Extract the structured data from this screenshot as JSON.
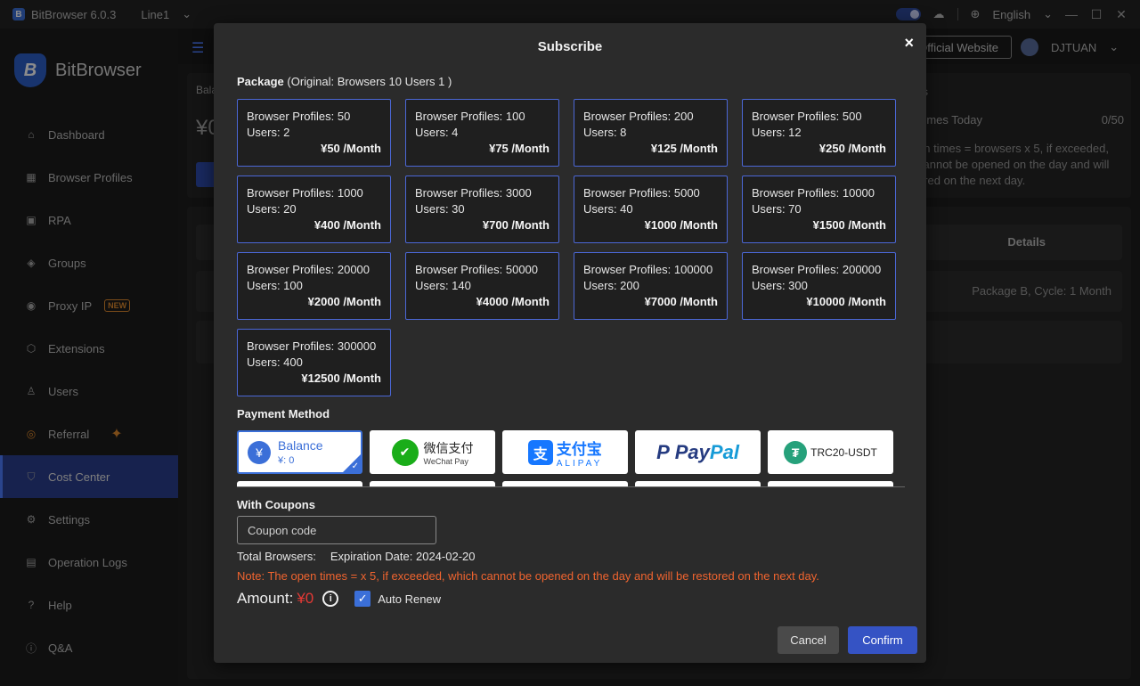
{
  "titlebar": {
    "app_title": "BitBrowser 6.0.3",
    "line": "Line1",
    "language": "English"
  },
  "sidebar": {
    "brand": "BitBrowser",
    "items": [
      {
        "label": "Dashboard",
        "icon": "home-icon"
      },
      {
        "label": "Browser Profiles",
        "icon": "grid-icon"
      },
      {
        "label": "RPA",
        "icon": "robot-icon"
      },
      {
        "label": "Groups",
        "icon": "layers-icon"
      },
      {
        "label": "Proxy IP",
        "icon": "location-icon",
        "badge": "NEW"
      },
      {
        "label": "Extensions",
        "icon": "cube-icon"
      },
      {
        "label": "Users",
        "icon": "users-icon"
      },
      {
        "label": "Referral",
        "icon": "referral-icon"
      },
      {
        "label": "Cost Center",
        "icon": "shield-icon",
        "active": true
      },
      {
        "label": "Settings",
        "icon": "gear-icon"
      },
      {
        "label": "Operation Logs",
        "icon": "log-icon"
      },
      {
        "label": "Help",
        "icon": "help-icon"
      },
      {
        "label": "Q&A",
        "icon": "info-icon"
      }
    ]
  },
  "header": {
    "official_website": "Official Website",
    "username": "DJTUAN"
  },
  "background": {
    "balance_label": "Bala",
    "balance_value": "¥0",
    "stats_title": "cs",
    "times_today_label": "Times Today",
    "times_today_value": "0/50",
    "stats_note": "en times = browsers x 5, if exceeded, cannot be opened on the day and will ored on the next day.",
    "details_header": "Details",
    "row_package": "Package B, Cycle: 1 Month"
  },
  "modal": {
    "title": "Subscribe",
    "close": "×",
    "package_label": "Package",
    "package_original": "(Original: Browsers 10 Users 1 )",
    "packages": [
      {
        "profiles": "Browser Profiles: 50",
        "users": "Users: 2",
        "price": "¥50 /Month"
      },
      {
        "profiles": "Browser Profiles: 100",
        "users": "Users: 4",
        "price": "¥75 /Month"
      },
      {
        "profiles": "Browser Profiles: 200",
        "users": "Users: 8",
        "price": "¥125 /Month"
      },
      {
        "profiles": "Browser Profiles: 500",
        "users": "Users: 12",
        "price": "¥250 /Month"
      },
      {
        "profiles": "Browser Profiles: 1000",
        "users": "Users: 20",
        "price": "¥400 /Month"
      },
      {
        "profiles": "Browser Profiles: 3000",
        "users": "Users: 30",
        "price": "¥700 /Month"
      },
      {
        "profiles": "Browser Profiles: 5000",
        "users": "Users: 40",
        "price": "¥1000 /Month"
      },
      {
        "profiles": "Browser Profiles: 10000",
        "users": "Users: 70",
        "price": "¥1500 /Month"
      },
      {
        "profiles": "Browser Profiles: 20000",
        "users": "Users: 100",
        "price": "¥2000 /Month"
      },
      {
        "profiles": "Browser Profiles: 50000",
        "users": "Users: 140",
        "price": "¥4000 /Month"
      },
      {
        "profiles": "Browser Profiles: 100000",
        "users": "Users: 200",
        "price": "¥7000 /Month"
      },
      {
        "profiles": "Browser Profiles: 200000",
        "users": "Users: 300",
        "price": "¥10000 /Month"
      },
      {
        "profiles": "Browser Profiles: 300000",
        "users": "Users: 400",
        "price": "¥12500 /Month"
      }
    ],
    "payment_label": "Payment Method",
    "payments": {
      "balance_title": "Balance",
      "balance_value": "¥: 0",
      "wechat_cn": "微信支付",
      "wechat_en": "WeChat Pay",
      "alipay_cn": "支付宝",
      "alipay_en": "ALIPAY",
      "paypal_a": "Pay",
      "paypal_b": "Pal",
      "usdt": "TRC20-USDT"
    },
    "coupon_label": "With Coupons",
    "coupon_placeholder": "Coupon code",
    "total_browsers": "Total Browsers:",
    "expiration": "Expiration Date: 2024-02-20",
    "note": "Note: The open times = x 5, if exceeded, which cannot be opened on the day and will be restored on the next day.",
    "amount_label": "Amount:",
    "amount_value": "¥0",
    "auto_renew": "Auto Renew",
    "cancel": "Cancel",
    "confirm": "Confirm"
  },
  "colors": {
    "accent": "#3b6fd8",
    "note": "#f0642f",
    "amount": "#e53935",
    "active_nav": "#2b3f8f"
  }
}
